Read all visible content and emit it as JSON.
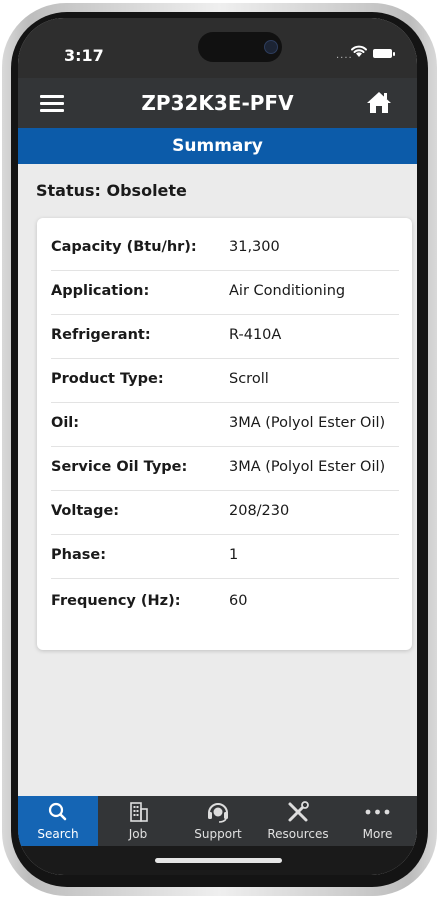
{
  "device": {
    "time": "3:17",
    "signal_dots": "....",
    "colors": {
      "appbar": "#333537",
      "band": "#0c5ba9",
      "active_tab": "#1565b4"
    }
  },
  "header": {
    "title": "ZP32K3E-PFV",
    "menu_icon": "hamburger-menu-icon",
    "home_icon": "home-icon"
  },
  "section": {
    "title": "Summary"
  },
  "status": {
    "text": "Status: Obsolete"
  },
  "specs": [
    {
      "label": "Capacity (Btu/hr):",
      "value": "31,300"
    },
    {
      "label": "Application:",
      "value": "Air Conditioning"
    },
    {
      "label": "Refrigerant:",
      "value": "R-410A"
    },
    {
      "label": "Product Type:",
      "value": "Scroll"
    },
    {
      "label": "Oil:",
      "value": "3MA (Polyol Ester Oil)"
    },
    {
      "label": "Service Oil Type:",
      "value": "3MA (Polyol Ester Oil)"
    },
    {
      "label": "Voltage:",
      "value": "208/230"
    },
    {
      "label": "Phase:",
      "value": "1"
    },
    {
      "label": "Frequency (Hz):",
      "value": "60"
    }
  ],
  "tabs": [
    {
      "label": "Search",
      "icon": "search-icon",
      "active": true
    },
    {
      "label": "Job",
      "icon": "building-icon",
      "active": false
    },
    {
      "label": "Support",
      "icon": "headset-icon",
      "active": false
    },
    {
      "label": "Resources",
      "icon": "tools-icon",
      "active": false
    },
    {
      "label": "More",
      "icon": "more-dots-icon",
      "active": false
    }
  ]
}
